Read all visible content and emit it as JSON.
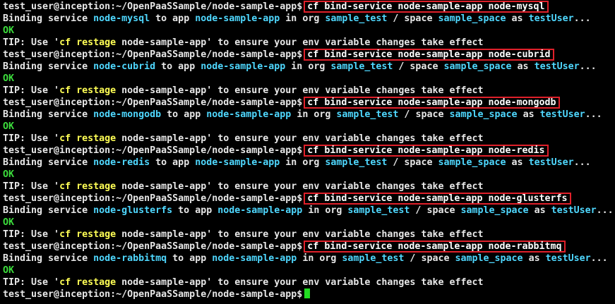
{
  "prompt": "test_user@inception:~/OpenPaaSSample/node-sample-app$",
  "binding": {
    "prefix": "Binding service ",
    "to_app": " to app ",
    "app": "node-sample-app",
    "in_org": " in org ",
    "org": "sample_test",
    "slash_space": " / space ",
    "space": "sample_space",
    "as": " as ",
    "user": "testUser",
    "ellipsis": "..."
  },
  "ok": "OK",
  "tip": {
    "prefix": "TIP: Use '",
    "cmd_cf": "cf",
    "cmd_restage": "restage",
    "suffix": " node-sample-app' to ensure your env variable changes take effect"
  },
  "commands": [
    {
      "command": "cf bind-service node-sample-app node-mysql",
      "service": "node-mysql"
    },
    {
      "command": "cf bind-service node-sample-app node-cubrid",
      "service": "node-cubrid"
    },
    {
      "command": "cf bind-service node-sample-app node-mongodb",
      "service": "node-mongodb"
    },
    {
      "command": "cf bind-service node-sample-app node-redis",
      "service": "node-redis"
    },
    {
      "command": "cf bind-service node-sample-app node-glusterfs",
      "service": "node-glusterfs"
    },
    {
      "command": "cf bind-service node-sample-app node-rabbitmq",
      "service": "node-rabbitmq"
    }
  ],
  "colors": {
    "background": "#000000",
    "highlight_box": "#e0202a",
    "cyan": "#4fd8ff",
    "ok_green": "#3cdc3c",
    "tip_yellow": "#ffff55",
    "cursor": "#22dd22"
  },
  "icons": [
    "cursor-block-icon"
  ]
}
